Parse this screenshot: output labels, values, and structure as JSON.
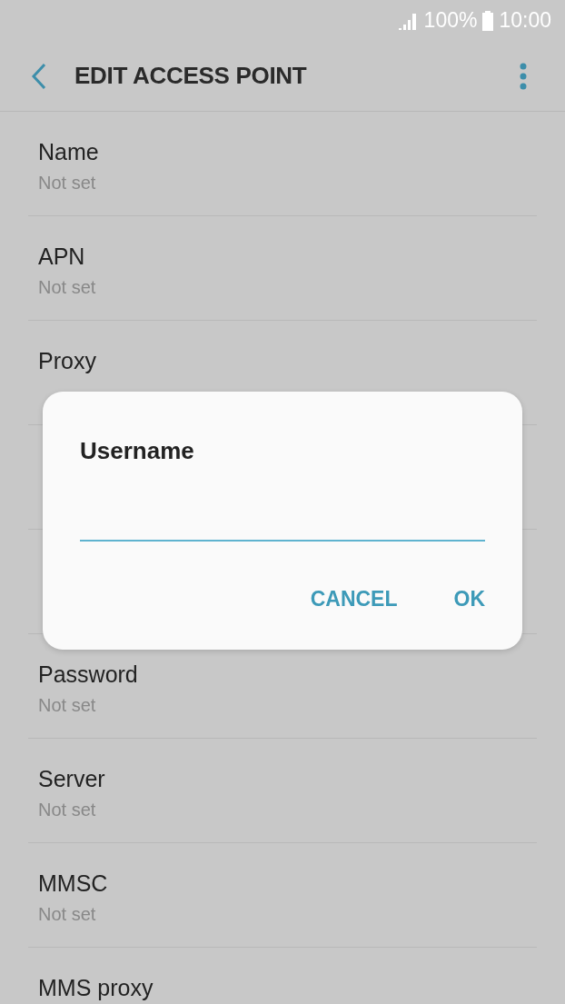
{
  "status_bar": {
    "battery": "100%",
    "time": "10:00"
  },
  "header": {
    "title": "EDIT ACCESS POINT"
  },
  "settings": [
    {
      "kind": "row",
      "title": "Name",
      "value": "Not set"
    },
    {
      "kind": "row",
      "title": "APN",
      "value": "Not set"
    },
    {
      "kind": "row",
      "title": "Proxy"
    },
    {
      "kind": "covered"
    },
    {
      "kind": "covered"
    },
    {
      "kind": "row",
      "title": "Password",
      "value": "Not set"
    },
    {
      "kind": "row",
      "title": "Server",
      "value": "Not set"
    },
    {
      "kind": "row",
      "title": "MMSC",
      "value": "Not set"
    },
    {
      "kind": "row",
      "title": "MMS proxy"
    }
  ],
  "dialog": {
    "title": "Username",
    "buttons": [
      "CANCEL",
      "OK"
    ]
  }
}
